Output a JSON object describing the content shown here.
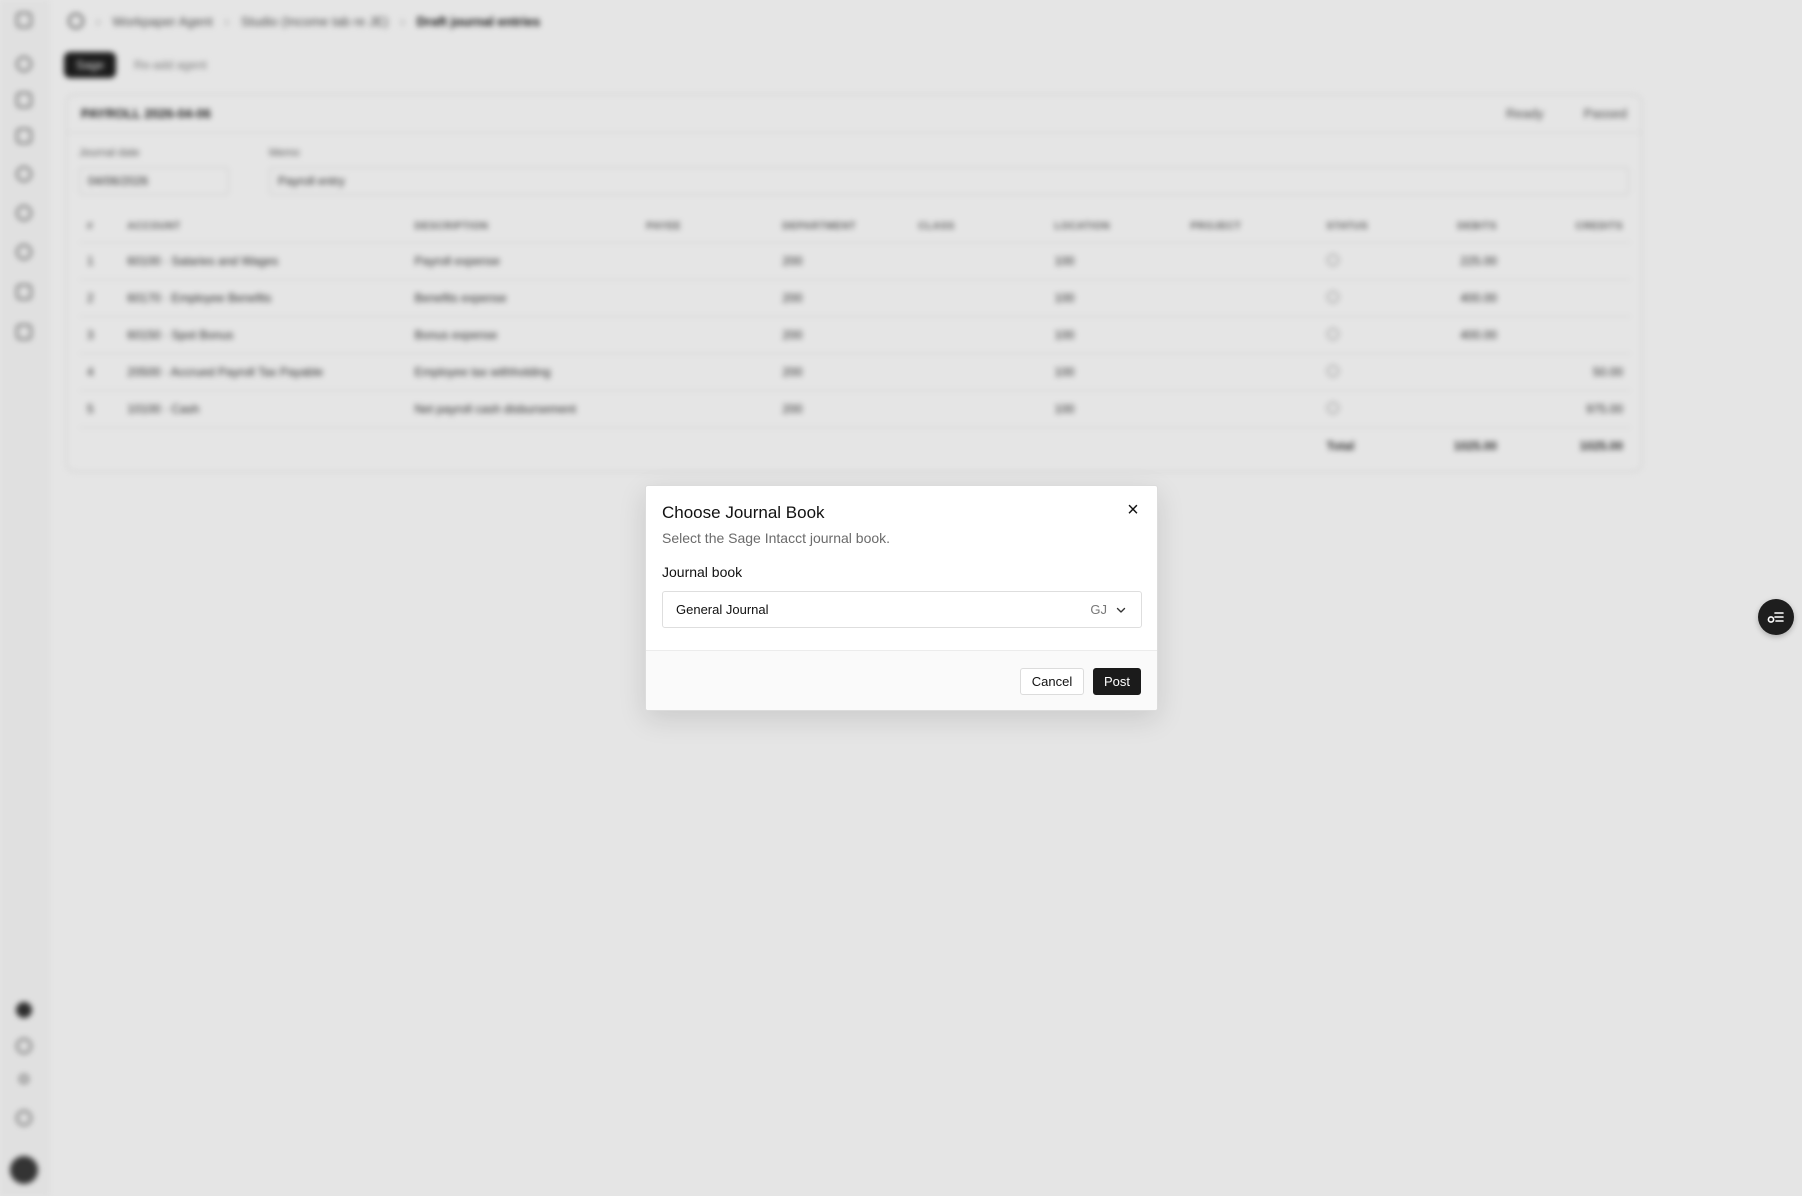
{
  "breadcrumb": {
    "items": [
      "Workpaper Agent",
      "Studio (Income tab re JE)",
      "Draft journal entries"
    ]
  },
  "tabs": [
    {
      "label": "Sage",
      "active": true
    },
    {
      "label": "Re-add agent",
      "active": false
    }
  ],
  "entry": {
    "title": "PAYROLL 2026-04-06",
    "actions": [
      "Ready",
      "Passed"
    ],
    "journal_date_label": "Journal date",
    "journal_date": "04/06/2026",
    "memo_label": "Memo",
    "memo": "Payroll entry"
  },
  "table": {
    "columns": [
      "#",
      "ACCOUNT",
      "DESCRIPTION",
      "PAYEE",
      "DEPARTMENT",
      "CLASS",
      "LOCATION",
      "PROJECT",
      "STATUS",
      "DEBITS",
      "CREDITS"
    ],
    "rows": [
      {
        "n": "1",
        "account": "60100 · Salaries and Wages",
        "description": "Payroll expense",
        "payee": "",
        "department": "200",
        "class": "",
        "location": "100",
        "project": "",
        "debit": "225.00",
        "credit": ""
      },
      {
        "n": "2",
        "account": "60170 · Employee Benefits",
        "description": "Benefits expense",
        "payee": "",
        "department": "200",
        "class": "",
        "location": "100",
        "project": "",
        "debit": "400.00",
        "credit": ""
      },
      {
        "n": "3",
        "account": "60150 · Spot Bonus",
        "description": "Bonus expense",
        "payee": "",
        "department": "200",
        "class": "",
        "location": "100",
        "project": "",
        "debit": "400.00",
        "credit": ""
      },
      {
        "n": "4",
        "account": "20500 · Accrued Payroll Tax Payable",
        "description": "Employee tax withholding",
        "payee": "",
        "department": "200",
        "class": "",
        "location": "100",
        "project": "",
        "debit": "",
        "credit": "50.00"
      },
      {
        "n": "5",
        "account": "10100 · Cash",
        "description": "Net payroll cash disbursement",
        "payee": "",
        "department": "200",
        "class": "",
        "location": "100",
        "project": "",
        "debit": "",
        "credit": "975.00"
      }
    ],
    "total_label": "Total",
    "total_debit": "1025.00",
    "total_credit": "1025.00"
  },
  "dialog": {
    "title": "Choose Journal Book",
    "description": "Select the Sage Intacct journal book.",
    "field_label": "Journal book",
    "selected_value": "General Journal",
    "selected_code": "GJ",
    "cancel_label": "Cancel",
    "post_label": "Post",
    "close_icon": "×"
  },
  "icons": {
    "close": "close-icon",
    "chevron": "chevron-down-icon",
    "fab": "checklist-icon"
  },
  "colors": {
    "primary_button": "#1b1b1b",
    "overlay": "rgba(0,0,0,0.10)"
  }
}
